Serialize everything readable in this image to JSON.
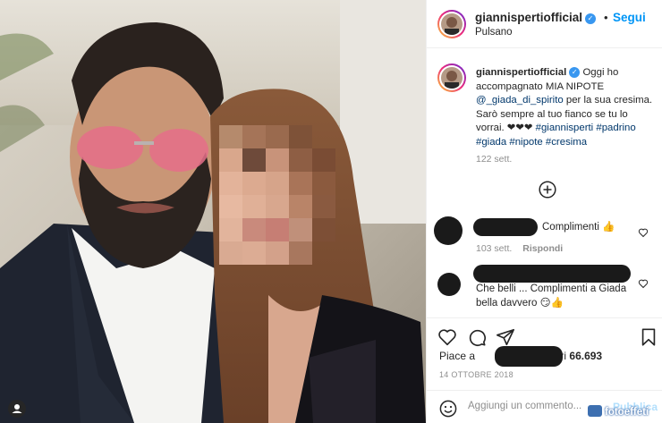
{
  "post": {
    "username": "giannispertiofficial",
    "follow_label": "Segui",
    "separator": "•",
    "location": "Pulsano",
    "caption": {
      "author": "giannispertiofficial",
      "text_1": "Oggi ho accompagnato MIA NIPOTE",
      "mention": "@_giada_di_spirito",
      "text_2": "per la sua cresima. Sarò sempre al tuo fianco se tu lo vorrai. ❤❤❤",
      "hashtags_1": "#giannisperti",
      "hashtags_2": "#padrino #giada #nipote #cresima",
      "time": "122 sett."
    },
    "comments": [
      {
        "text": "Complimenti 👍",
        "time": "103 sett.",
        "reply_label": "Rispondi"
      },
      {
        "text": "Che belli ... Complimenti a Giada bella davvero 😏👍"
      }
    ],
    "likes": {
      "prefix": "Piace a",
      "suffix": "e altri",
      "count": "66.693"
    },
    "date": "14 OTTOBRE 2018",
    "add_comment_placeholder": "Aggiungi un commento...",
    "publish_label": "Pubblica"
  },
  "icons": {
    "verified": "verified-badge-icon",
    "add_more": "plus-circle-icon",
    "like": "heart-icon",
    "comment": "comment-bubble-icon",
    "share": "paper-plane-icon",
    "save": "bookmark-icon",
    "emoji": "emoji-icon",
    "tag": "user-tag-icon"
  },
  "colors": {
    "accent": "#0095f6",
    "verified": "#3897f0",
    "muted": "#8e8e8e"
  },
  "watermark": "fotoeffeti"
}
